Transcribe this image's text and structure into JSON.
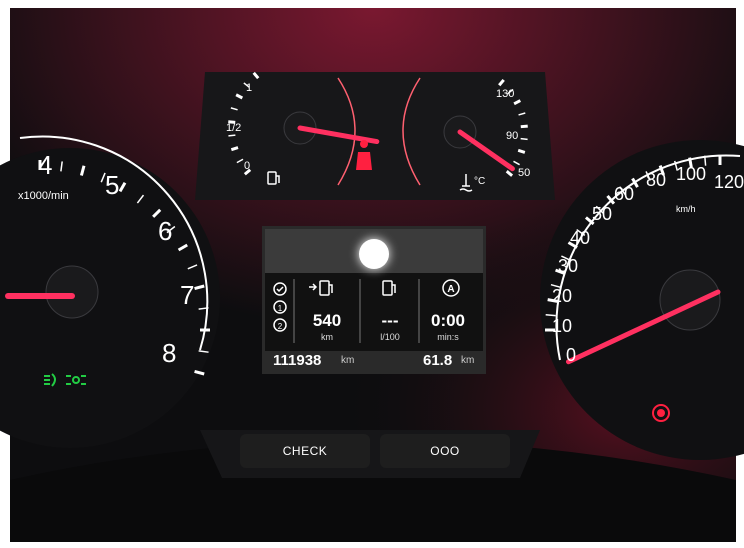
{
  "tachometer": {
    "unit": "x1000/min",
    "ticks": [
      "4",
      "5",
      "6",
      "7",
      "8"
    ],
    "redline_from": 5
  },
  "fuel_gauge": {
    "ticks": [
      "1",
      "1/2",
      "0"
    ],
    "level": 0.75
  },
  "temp_gauge": {
    "ticks": [
      "130",
      "90",
      "50"
    ],
    "unit": "°C",
    "value": 62
  },
  "speedometer": {
    "unit": "km/h",
    "ticks": [
      "0",
      "10",
      "20",
      "30",
      "40",
      "50",
      "60",
      "80",
      "100",
      "120"
    ],
    "value": 0
  },
  "trip_display": {
    "range": {
      "value": "540",
      "unit": "km"
    },
    "consumption": {
      "value": "---",
      "unit": "l/100"
    },
    "time": {
      "value": "0:00",
      "unit": "min:s"
    },
    "odometer": {
      "value": "111938",
      "unit": "km"
    },
    "trip": {
      "value": "61.8",
      "unit": "km"
    }
  },
  "buttons": {
    "check": "CHECK",
    "ooo": "OOO"
  },
  "colors": {
    "needle": "#ff3060",
    "warning_red": "#ff2040",
    "lights_green": "#22cc44",
    "scale_white": "#ffffff"
  },
  "icons": [
    "seat-belt-warning-icon",
    "fuel-pump-icon",
    "coolant-temperature-icon",
    "parking-brake-icon",
    "low-beam-icon",
    "sidelights-icon",
    "range-arrow-fuel-icon",
    "auto-stop-start-icon",
    "trip-selector-icon"
  ]
}
